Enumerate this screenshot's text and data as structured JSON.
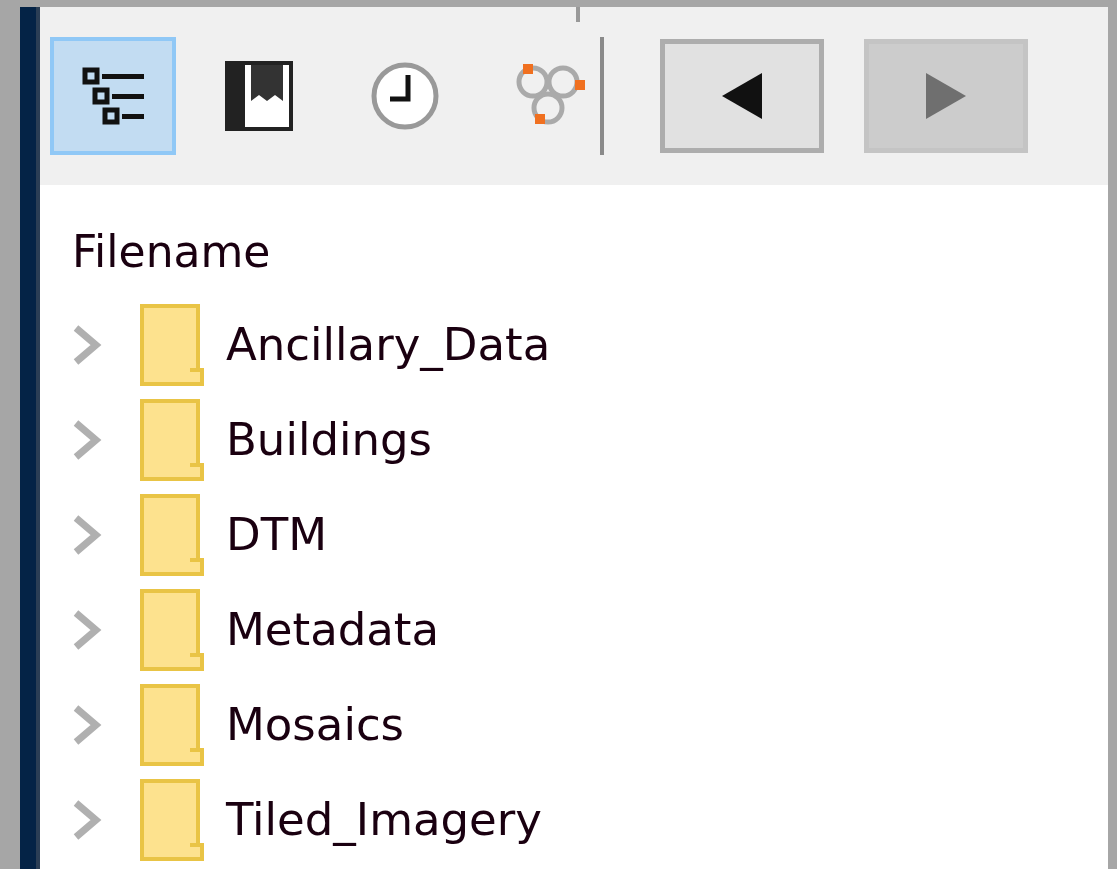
{
  "toolbar": {
    "view_buttons": [
      {
        "kind": "tree",
        "selected": true
      },
      {
        "kind": "bookmark",
        "selected": false
      },
      {
        "kind": "history",
        "selected": false
      },
      {
        "kind": "network",
        "selected": false
      }
    ],
    "nav_buttons": [
      {
        "kind": "back",
        "disabled": false
      },
      {
        "kind": "forward",
        "disabled": true
      }
    ]
  },
  "tree": {
    "header": "Filename",
    "items": [
      {
        "label": "Ancillary_Data",
        "expanded": false
      },
      {
        "label": "Buildings",
        "expanded": false
      },
      {
        "label": "DTM",
        "expanded": false
      },
      {
        "label": "Metadata",
        "expanded": false
      },
      {
        "label": "Mosaics",
        "expanded": false
      },
      {
        "label": "Tiled_Imagery",
        "expanded": false
      }
    ]
  }
}
